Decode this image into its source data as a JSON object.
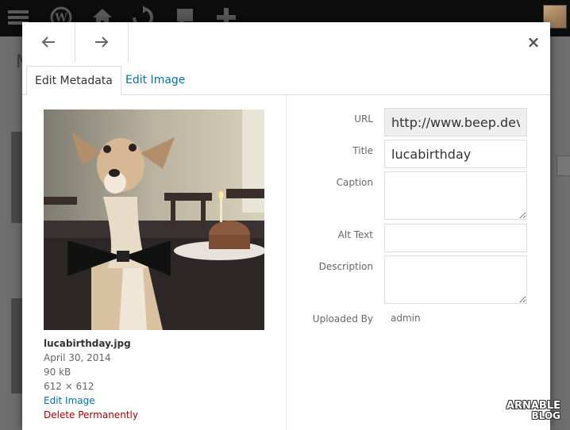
{
  "modal": {
    "tabs": [
      {
        "label": "Edit Metadata"
      },
      {
        "label": "Edit Image"
      }
    ],
    "close_symbol": "×"
  },
  "attachment": {
    "filename": "lucabirthday.jpg",
    "date": "April 30, 2014",
    "filesize": "90 kB",
    "dimensions": "612 × 612",
    "edit_link": "Edit Image",
    "delete_link": "Delete Permanently"
  },
  "fields": {
    "url": {
      "label": "URL",
      "value": "http://www.beep.dev/"
    },
    "title": {
      "label": "Title",
      "value": "lucabirthday"
    },
    "caption": {
      "label": "Caption",
      "value": ""
    },
    "alt_text": {
      "label": "Alt Text",
      "value": ""
    },
    "description": {
      "label": "Description",
      "value": ""
    },
    "uploaded_by": {
      "label": "Uploaded By",
      "value": "admin"
    }
  },
  "watermark": {
    "line1": "ARNABLE",
    "line2": "BLOG"
  },
  "colors": {
    "accent": "#0073aa",
    "danger": "#a00000",
    "topbar": "#0d0d0d"
  },
  "icons": [
    "wordpress-icon",
    "home-icon",
    "refresh-icon",
    "comment-icon",
    "plus-icon",
    "arrow-left-icon",
    "arrow-right-icon",
    "close-icon"
  ]
}
